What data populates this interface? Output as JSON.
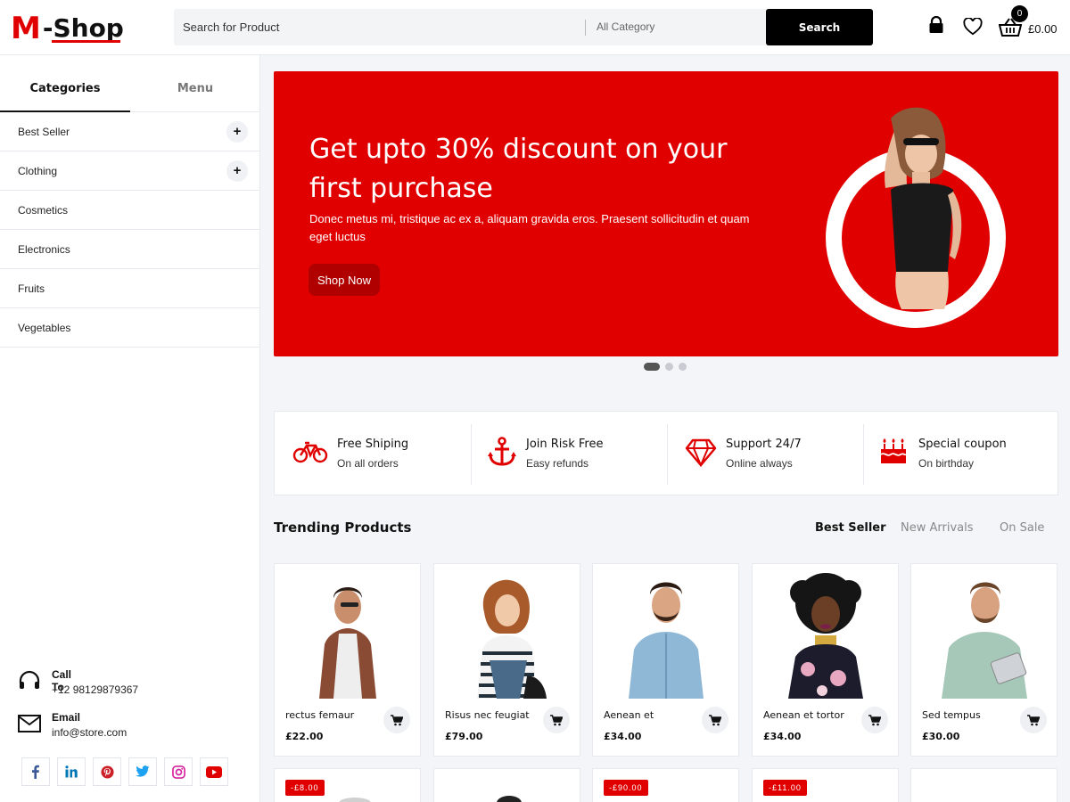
{
  "brand": {
    "logo_m": "M",
    "logo_rest": "-Shop"
  },
  "search": {
    "placeholder": "Search for Product",
    "category": "All Category",
    "button": "Search"
  },
  "header": {
    "cart_count": "0",
    "cart_total": "£0.00"
  },
  "sidebar": {
    "tabs": [
      "Categories",
      "Menu"
    ],
    "categories": [
      "Best Seller",
      "Clothing",
      "Cosmetics",
      "Electronics",
      "Fruits",
      "Vegetables"
    ],
    "contact": {
      "call_title": "Call To",
      "call_value": "+12 98129879367",
      "email_title": "Email",
      "email_value": "info@store.com"
    },
    "socials": [
      "facebook-icon",
      "linkedin-icon",
      "pinterest-icon",
      "twitter-icon",
      "instagram-icon",
      "youtube-icon"
    ]
  },
  "hero": {
    "title_line1": "Get upto 30% discount on your",
    "title_line2": "first purchase",
    "subtitle": "Donec metus mi, tristique ac ex a, aliquam gravida eros. Praesent sollicitudin et quam eget luctus",
    "button": "Shop Now",
    "slides": 3,
    "active_slide": 1
  },
  "features": [
    {
      "icon": "bicycle-icon",
      "title": "Free Shiping",
      "sub": "On all orders"
    },
    {
      "icon": "anchor-icon",
      "title": "Join Risk Free",
      "sub": "Easy refunds"
    },
    {
      "icon": "diamond-icon",
      "title": "Support 24/7",
      "sub": "Online always"
    },
    {
      "icon": "cake-icon",
      "title": "Special coupon",
      "sub": "On birthday"
    }
  ],
  "trending": {
    "title": "Trending Products",
    "tabs": [
      "Best Seller",
      "New Arrivals",
      "On Sale"
    ],
    "products": [
      {
        "name": "rectus femaur",
        "price": "£22.00"
      },
      {
        "name": "Risus nec feugiat",
        "price": "£79.00"
      },
      {
        "name": "Aenean et",
        "price": "£34.00"
      },
      {
        "name": "Aenean et tortor",
        "price": "£34.00"
      },
      {
        "name": "Sed tempus",
        "price": "£30.00"
      }
    ],
    "badges": [
      "-£8.00",
      "",
      "-£90.00",
      "-£11.00",
      ""
    ]
  },
  "colors": {
    "accent": "#e00000",
    "dark": "#000000",
    "bg": "#f3f5f8"
  }
}
